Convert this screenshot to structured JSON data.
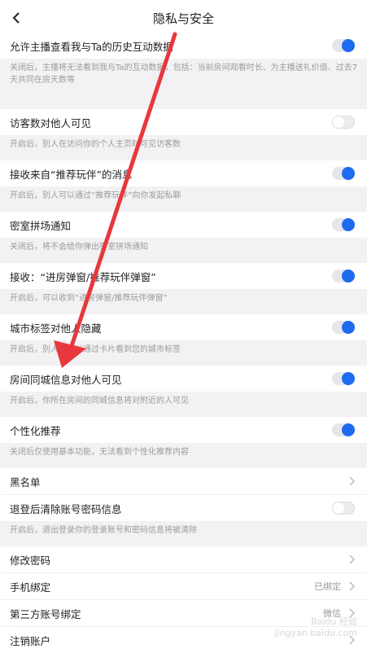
{
  "header": {
    "title": "隐私与安全",
    "back_icon": "chevron-left-icon"
  },
  "settings": [
    {
      "label": "允许主播查看我与Ta的历史互动数据",
      "toggle": "on",
      "desc": "关闭后，主播将无法看到我与Ta的互动数据，包括：当前房间观看时长、为主播送礼价值、过去7天共同在房天数等"
    },
    {
      "label": "访客数对他人可见",
      "toggle": "off",
      "desc": "开启后，别人在访问你的个人主页时可见访客数"
    },
    {
      "label": "接收来自“推荐玩伴”的消息",
      "toggle": "on",
      "desc": "开启后，别人可以通过“推荐玩伴”向你发起私聊"
    },
    {
      "label": "密室拼场通知",
      "toggle": "on",
      "desc": "关闭后，将不会给你弹出密室拼场通知"
    },
    {
      "label": "接收：“进房弹窗/推荐玩伴弹窗”",
      "toggle": "on",
      "desc": "开启后，可以收到“进房弹窗/推荐玩伴弹窗”"
    },
    {
      "label": "城市标签对他人隐藏",
      "toggle": "on",
      "desc": "开启后，别人不可以通过卡片看到您的城市标签"
    },
    {
      "label": "房间同城信息对他人可见",
      "toggle": "on",
      "desc": "开启后，你所在房间的同城信息将对附近的人可见"
    },
    {
      "label": "个性化推荐",
      "toggle": "on",
      "desc": "关闭后仅使用基本功能，无法看到个性化推荐内容"
    }
  ],
  "blacklist": {
    "label": "黑名单"
  },
  "logout_clear": {
    "label": "退登后清除账号密码信息",
    "toggle": "off",
    "desc": "开启后，退出登录你的登录账号和密码信息将被清除"
  },
  "account_links": [
    {
      "label": "修改密码",
      "value": ""
    },
    {
      "label": "手机绑定",
      "value": "已绑定"
    },
    {
      "label": "第三方账号绑定",
      "value": "微信"
    },
    {
      "label": "注销账户",
      "value": ""
    }
  ],
  "watermark": {
    "line1": "Baidu 经验",
    "line2": "jingyan.baidu.com"
  },
  "colors": {
    "toggle_on": "#1e6bf0",
    "annotation_arrow": "#e8383d"
  }
}
